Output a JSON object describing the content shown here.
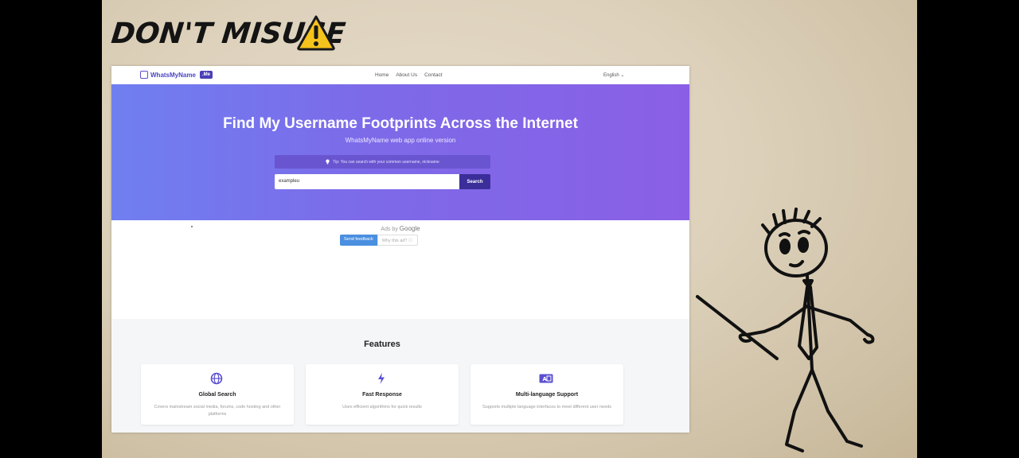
{
  "overlay": {
    "headline": "DON'T MISUSE",
    "warning_icon": "warning-triangle-icon"
  },
  "site": {
    "logo_text": "WhatsMyName",
    "logo_badge": ".Me",
    "nav_links": [
      "Home",
      "About Us",
      "Contact"
    ],
    "language": "English ⌄"
  },
  "hero": {
    "title": "Find My Username Footprints Across the Internet",
    "subtitle": "WhatsMyName web app online version",
    "tip": "Tip: You can search with your common username, nickname",
    "search_value": "examplеu",
    "search_button": "Search"
  },
  "ads": {
    "label": "Ads by",
    "brand": "Google",
    "send_feedback": "Send feedback",
    "why_this_ad": "Why this ad? ⓘ"
  },
  "features": {
    "title": "Features",
    "cards": [
      {
        "icon": "globe-icon",
        "title": "Global Search",
        "desc": "Covers mainstream social media, forums, code hosting and other platforms"
      },
      {
        "icon": "lightning-icon",
        "title": "Fast Response",
        "desc": "Uses efficient algorithms for quick results"
      },
      {
        "icon": "translate-icon",
        "title": "Multi-language Support",
        "desc": "Supports multiple language interfaces to meet different user needs"
      }
    ]
  },
  "colors": {
    "hero_start": "#6f7ff0",
    "hero_end": "#8a5fe6",
    "button": "#3b2e9a",
    "accent": "#5b4fd1"
  }
}
